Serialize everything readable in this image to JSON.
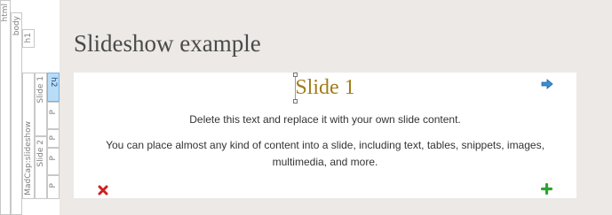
{
  "structure_bar": {
    "html": "html",
    "body": "body",
    "h1": "h1",
    "madcap_slideshow": "MadCap:slideshow",
    "slide1": "Slide 1",
    "h2": "h2",
    "slide2": "Slide 2",
    "p1": "P",
    "p2": "P",
    "p3": "P",
    "p4": "P"
  },
  "page": {
    "title": "Slideshow example"
  },
  "slide": {
    "heading": "Slide 1",
    "paragraph1": "Delete this text and replace it with your own slide content.",
    "paragraph2_line1": "You can place almost any kind of content into a slide, including text, tables, snippets, images,",
    "paragraph2_line2": "multimedia, and more."
  },
  "icons": {
    "next": "arrow-right-icon",
    "delete": "delete-x-icon",
    "add": "add-plus-icon"
  },
  "colors": {
    "heading": "#a17d18",
    "title": "#4a4a4a",
    "selected_structure": "#b9dcf7",
    "arrow": "#3a8fd6",
    "delete": "#d01f1f",
    "add": "#2ea52e"
  }
}
